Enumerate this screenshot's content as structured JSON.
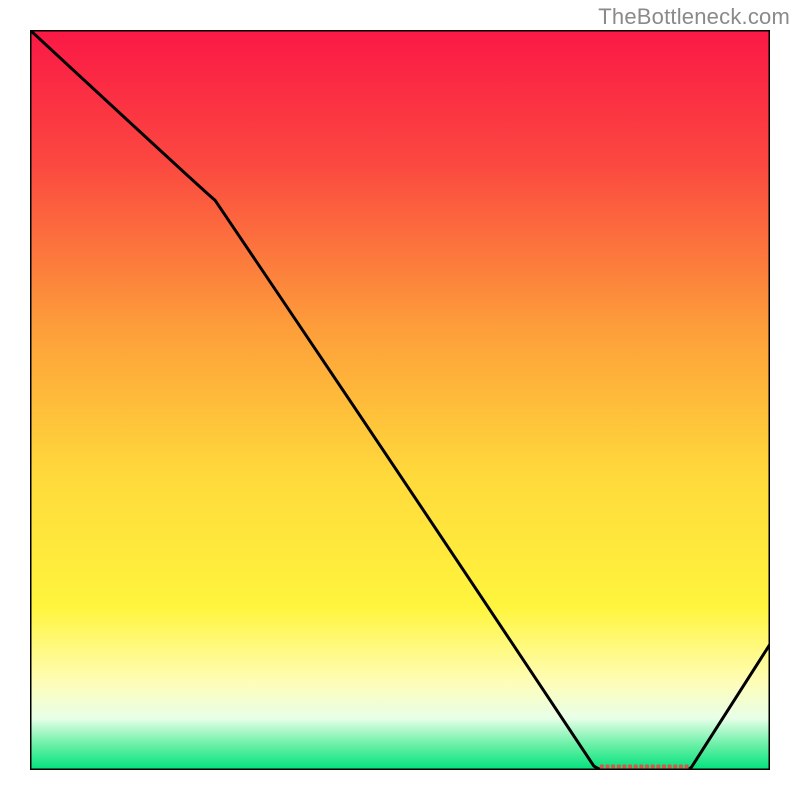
{
  "attribution": "TheBottleneck.com",
  "chart_data": {
    "type": "line",
    "title": "",
    "xlabel": "",
    "ylabel": "",
    "xlim": [
      0,
      100
    ],
    "ylim": [
      0,
      100
    ],
    "curve": {
      "name": "bottleneck-curve",
      "x": [
        0,
        25,
        77,
        89,
        100
      ],
      "y": [
        100,
        77,
        0,
        0,
        17
      ]
    },
    "flat_marker": {
      "x_start": 77,
      "x_end": 89,
      "y": 0,
      "color": "#d9544d"
    },
    "gradient_stops": [
      {
        "offset": 0.0,
        "color": "#fb1846"
      },
      {
        "offset": 0.18,
        "color": "#fb4840"
      },
      {
        "offset": 0.4,
        "color": "#fd9d3a"
      },
      {
        "offset": 0.6,
        "color": "#ffd93b"
      },
      {
        "offset": 0.78,
        "color": "#fff53d"
      },
      {
        "offset": 0.88,
        "color": "#fffdb6"
      },
      {
        "offset": 0.93,
        "color": "#e8ffe8"
      },
      {
        "offset": 0.965,
        "color": "#6df0a8"
      },
      {
        "offset": 1.0,
        "color": "#00e27b"
      }
    ]
  }
}
